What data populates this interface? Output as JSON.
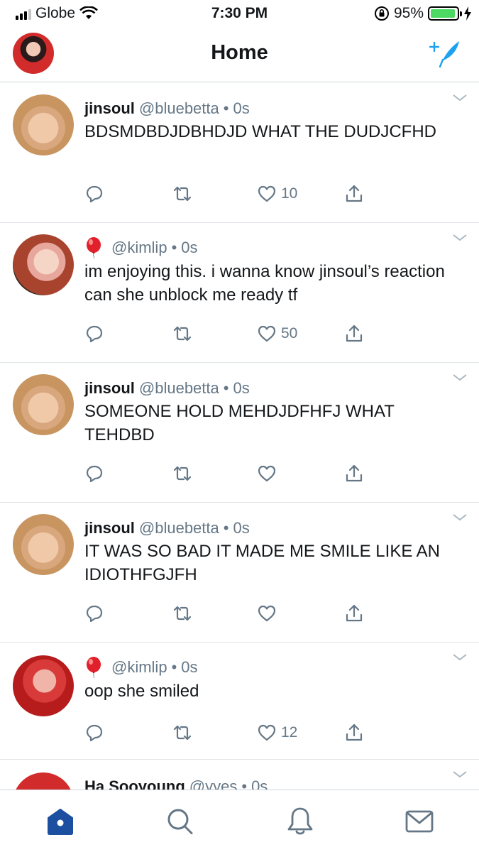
{
  "status_bar": {
    "carrier": "Globe",
    "time": "7:30 PM",
    "battery": "95%",
    "battery_level": 0.95
  },
  "header": {
    "title": "Home"
  },
  "tweets": [
    {
      "name": "jinsoul",
      "handle": "@bluebetta",
      "separator": "•",
      "time": "0s",
      "text": "BDSMDBDJDBHDJD WHAT THE DUDJCFHD",
      "likes": "10",
      "avatar": "blonde"
    },
    {
      "name": "",
      "name_icon": "balloon-emoji",
      "handle": "@kimlip",
      "separator": "•",
      "time": "0s",
      "text": "im enjoying this. i wanna know jinsoul’s reaction can she unblock me ready tf",
      "likes": "50",
      "avatar": "red1"
    },
    {
      "name": "jinsoul",
      "handle": "@bluebetta",
      "separator": "•",
      "time": "0s",
      "text": "SOMEONE HOLD MEHDJDFHFJ WHAT TEHDBD",
      "likes": "",
      "avatar": "blonde"
    },
    {
      "name": "jinsoul",
      "handle": "@bluebetta",
      "separator": "•",
      "time": "0s",
      "text": "IT WAS SO BAD IT MADE ME SMILE LIKE AN IDIOTHFGJFH",
      "likes": "",
      "avatar": "blonde"
    },
    {
      "name": "",
      "name_icon": "balloon-emoji",
      "handle": "@kimlip",
      "separator": "•",
      "time": "0s",
      "text": "oop she smiled",
      "likes": "12",
      "avatar": "red2"
    },
    {
      "name": "Ha Sooyoung",
      "handle": "@yyes",
      "separator": "•",
      "time": "0s",
      "text": "",
      "likes": "",
      "avatar": "red3"
    }
  ],
  "tab_bar": {
    "tabs": [
      "home-icon",
      "search-icon",
      "notifications-icon",
      "messages-icon"
    ],
    "active": "home-icon"
  },
  "colors": {
    "accent": "#1da1f2",
    "tab_active": "#1c4fa0",
    "secondary_text": "#657786",
    "divider": "#dfe4e8"
  }
}
